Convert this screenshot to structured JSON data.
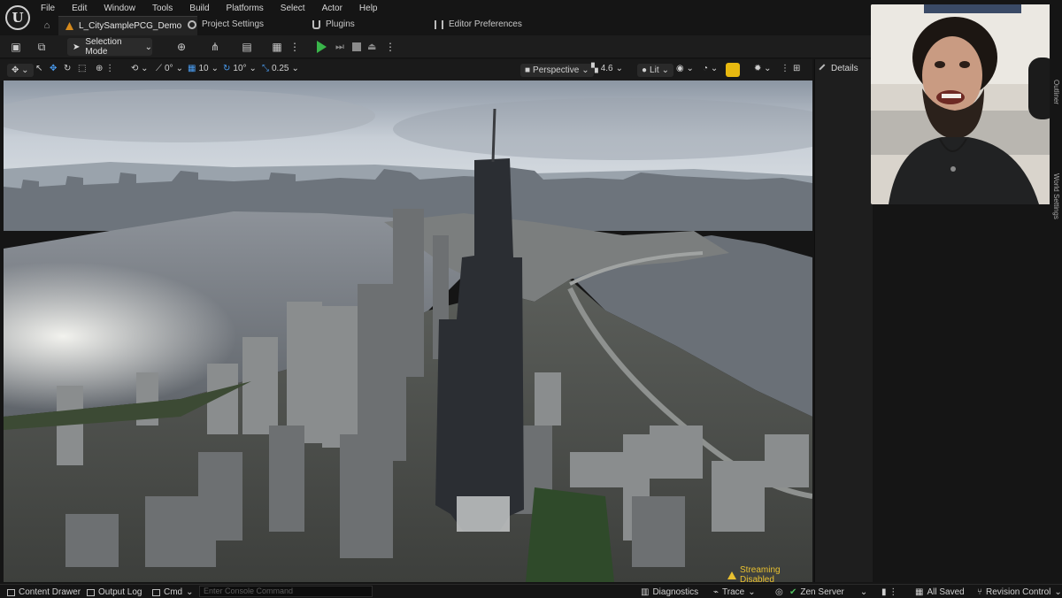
{
  "menu": {
    "items": [
      "File",
      "Edit",
      "Window",
      "Tools",
      "Build",
      "Platforms",
      "Select",
      "Actor",
      "Help"
    ]
  },
  "logo_text": "U",
  "tabs": {
    "level": "L_CitySamplePCG_Demo",
    "project_settings": "Project Settings",
    "plugins": "Plugins",
    "editor_preferences": "Editor Preferences"
  },
  "toolbar": {
    "selection_mode": "Selection Mode"
  },
  "viewport_header": {
    "rotate_snap": "0°",
    "grid_snap": "10",
    "angle_snap": "10°",
    "scale_snap": "0.25",
    "perspective": "Perspective",
    "camera_speed": "4.6",
    "view_mode": "Lit"
  },
  "viewport": {
    "streaming_status": "Streaming Disabled"
  },
  "details_panel": {
    "title": "Details"
  },
  "side_tabs": {
    "outliner": "Outliner",
    "world_settings": "World Settings"
  },
  "status_bar": {
    "content_drawer": "Content Drawer",
    "output_log": "Output Log",
    "cmd": "Cmd",
    "console_placeholder": "Enter Console Command",
    "diagnostics": "Diagnostics",
    "trace": "Trace",
    "zen_server": "Zen Server",
    "all_saved": "All Saved",
    "revision_control": "Revision Control"
  },
  "colors": {
    "play_green": "#39b54a",
    "warning_yellow": "#e8c030",
    "level_tab_orange": "#d68a1c"
  }
}
